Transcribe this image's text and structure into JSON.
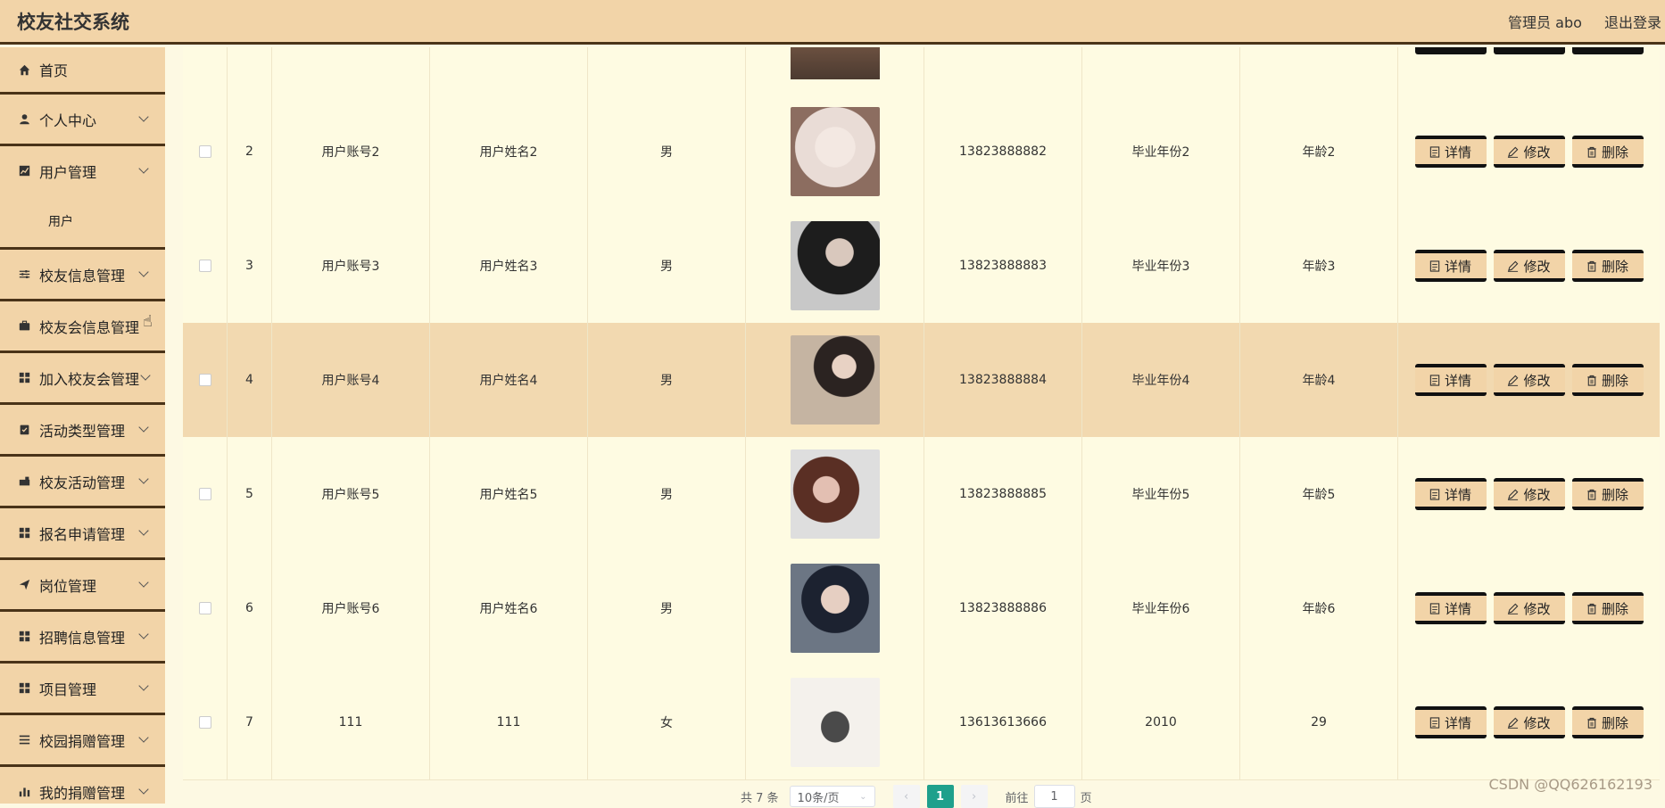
{
  "header": {
    "title": "校友社交系统",
    "user": "管理员 abo",
    "logout": "退出登录"
  },
  "sidebar": {
    "items": [
      {
        "label": "首页",
        "icon": "home-icon"
      },
      {
        "label": "个人中心",
        "icon": "user-icon"
      },
      {
        "label": "用户管理",
        "icon": "chart-icon"
      },
      {
        "label": "校友信息管理",
        "icon": "sliders-icon"
      },
      {
        "label": "校友会信息管理",
        "icon": "briefcase-icon"
      },
      {
        "label": "加入校友会管理",
        "icon": "grid-icon"
      },
      {
        "label": "活动类型管理",
        "icon": "clipboard-icon"
      },
      {
        "label": "校友活动管理",
        "icon": "truck-icon"
      },
      {
        "label": "报名申请管理",
        "icon": "grid-icon"
      },
      {
        "label": "岗位管理",
        "icon": "send-icon"
      },
      {
        "label": "招聘信息管理",
        "icon": "grid-icon"
      },
      {
        "label": "项目管理",
        "icon": "grid-icon"
      },
      {
        "label": "校园捐赠管理",
        "icon": "list-icon"
      },
      {
        "label": "我的捐赠管理",
        "icon": "bar-chart-icon"
      }
    ],
    "submenu_user": "用户"
  },
  "table": {
    "rows": [
      {
        "idx": "2",
        "account": "用户账号2",
        "name": "用户姓名2",
        "gender": "男",
        "phone": "13823888882",
        "year": "毕业年份2",
        "age": "年龄2"
      },
      {
        "idx": "3",
        "account": "用户账号3",
        "name": "用户姓名3",
        "gender": "男",
        "phone": "13823888883",
        "year": "毕业年份3",
        "age": "年龄3"
      },
      {
        "idx": "4",
        "account": "用户账号4",
        "name": "用户姓名4",
        "gender": "男",
        "phone": "13823888884",
        "year": "毕业年份4",
        "age": "年龄4"
      },
      {
        "idx": "5",
        "account": "用户账号5",
        "name": "用户姓名5",
        "gender": "男",
        "phone": "13823888885",
        "year": "毕业年份5",
        "age": "年龄5"
      },
      {
        "idx": "6",
        "account": "用户账号6",
        "name": "用户姓名6",
        "gender": "男",
        "phone": "13823888886",
        "year": "毕业年份6",
        "age": "年龄6"
      },
      {
        "idx": "7",
        "account": "111",
        "name": "111",
        "gender": "女",
        "phone": "13613613666",
        "year": "2010",
        "age": "29"
      }
    ],
    "actions": {
      "detail": "详情",
      "edit": "修改",
      "delete": "删除"
    }
  },
  "pagination": {
    "total": "共 7 条",
    "page_size": "10条/页",
    "current": "1",
    "goto_prefix": "前往",
    "goto_value": "1",
    "goto_suffix": "页"
  },
  "watermark": "CSDN @QQ626162193",
  "colors": {
    "header_bg": "#f2d4a8",
    "accent_dark": "#4a3318",
    "page_bg": "#fdf9e3",
    "pager_active": "#1fa08c"
  }
}
